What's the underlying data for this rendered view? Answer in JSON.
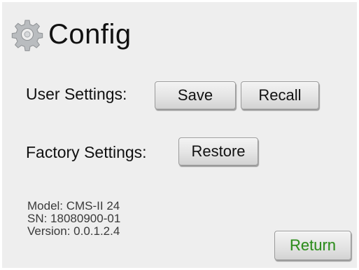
{
  "header": {
    "title": "Config",
    "icon": "gear-icon"
  },
  "user_settings": {
    "label": "User Settings:",
    "save_label": "Save",
    "recall_label": "Recall"
  },
  "factory_settings": {
    "label": "Factory Settings:",
    "restore_label": "Restore"
  },
  "device_info": {
    "model": "Model: CMS-II 24",
    "serial": "SN: 18080900-01",
    "version": "Version: 0.0.1.2.4"
  },
  "footer": {
    "return_label": "Return"
  },
  "colors": {
    "panel_background": "#eeeeee",
    "return_text": "#2e8b1f",
    "gear_icon": "#b9bcbf"
  }
}
